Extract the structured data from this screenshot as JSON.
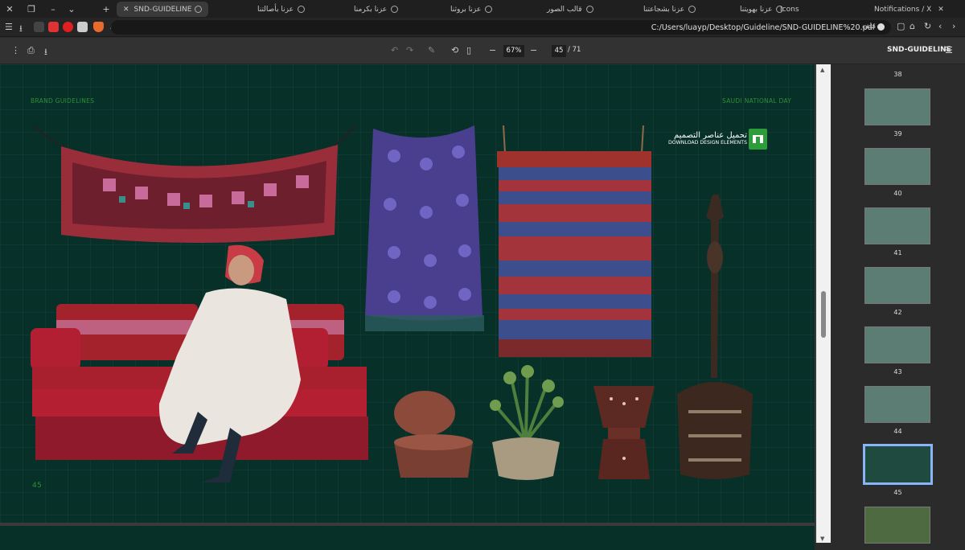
{
  "tabbar": {
    "tabs": [
      {
        "label": "SND-GUIDELINE",
        "active": true
      },
      {
        "label": "عزنا بأصالتنا"
      },
      {
        "label": "عزنا بكرمنا"
      },
      {
        "label": "عزنا بروثنا"
      },
      {
        "label": "قالب الصور"
      },
      {
        "label": "عزنا بشجاعتنا"
      },
      {
        "label": "عزنا بهويتنا"
      },
      {
        "label": "Icons"
      },
      {
        "label": "Notifications / X"
      }
    ]
  },
  "address": {
    "url": "C:/Users/luayp/Desktop/Guideline/SND-GUIDELINE%20.pdf",
    "file_label": "ملف"
  },
  "pdf": {
    "zoom": "67%",
    "page": "45",
    "total": "/ 71",
    "title": "SND-GUIDELINE"
  },
  "slide": {
    "top_left": "BRAND GUIDELINES",
    "top_right": "SAUDI NATIONAL DAY",
    "page_number": "45",
    "download_ar": "تحميل عناصر التصميم",
    "download_en": "DOWNLOAD DESIGN ELEMENTS"
  },
  "thumbnails": [
    "38",
    "39",
    "40",
    "41",
    "42",
    "43",
    "44",
    "45"
  ],
  "colors": {
    "page_bg": "#073029",
    "accent": "#2d8f35",
    "selected": "#8ab4f8"
  }
}
